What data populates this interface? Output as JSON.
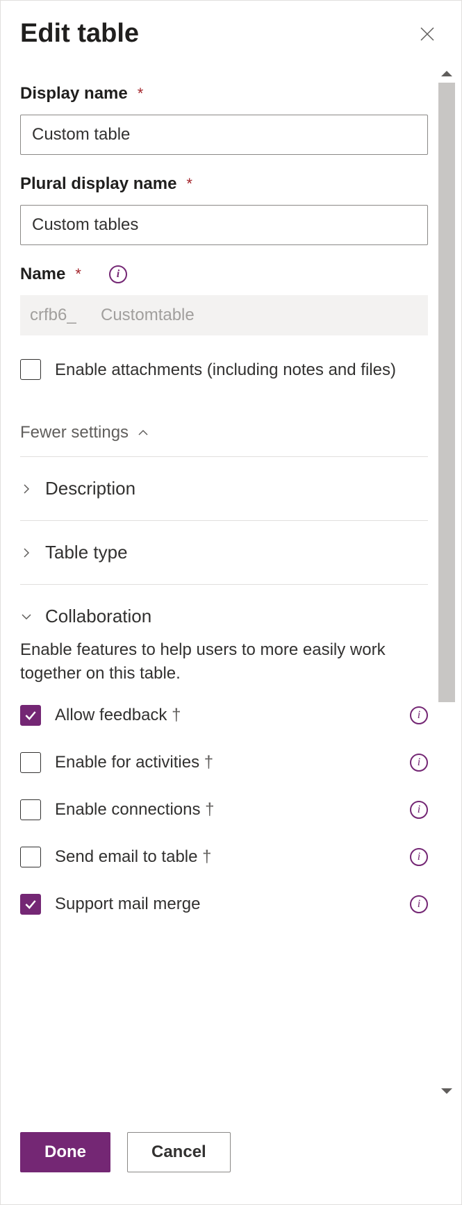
{
  "header": {
    "title": "Edit table"
  },
  "fields": {
    "display_name": {
      "label": "Display name",
      "value": "Custom table"
    },
    "plural_display_name": {
      "label": "Plural display name",
      "value": "Custom tables"
    },
    "name": {
      "label": "Name",
      "prefix": "crfb6_",
      "value": "Customtable"
    },
    "enable_attachments": {
      "label": "Enable attachments (including notes and files)",
      "checked": false
    }
  },
  "settings_toggle": "Fewer settings",
  "sections": {
    "description": {
      "title": "Description",
      "expanded": false
    },
    "table_type": {
      "title": "Table type",
      "expanded": false
    },
    "collaboration": {
      "title": "Collaboration",
      "expanded": true,
      "description": "Enable features to help users to more easily work together on this table.",
      "items": [
        {
          "label": "Allow feedback",
          "dagger": true,
          "checked": true,
          "info": true
        },
        {
          "label": "Enable for activities",
          "dagger": true,
          "checked": false,
          "info": true
        },
        {
          "label": "Enable connections",
          "dagger": true,
          "checked": false,
          "info": true
        },
        {
          "label": "Send email to table",
          "dagger": true,
          "checked": false,
          "info": true
        },
        {
          "label": "Support mail merge",
          "dagger": false,
          "checked": true,
          "info": true
        }
      ]
    }
  },
  "footer": {
    "done": "Done",
    "cancel": "Cancel"
  },
  "colors": {
    "accent": "#742774"
  }
}
